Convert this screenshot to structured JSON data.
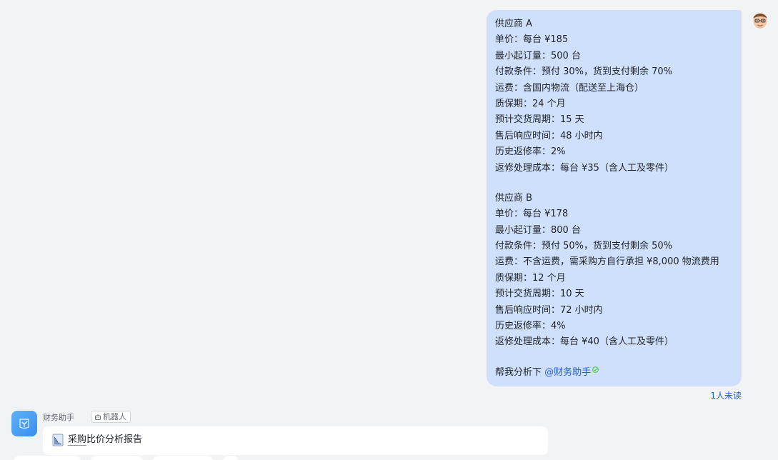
{
  "user_message": {
    "supplier_a": {
      "header": "供应商 A",
      "lines": [
        "单价：每台 ¥185",
        "最小起订量：500 台",
        "付款条件：预付 30%，货到支付剩余 70%",
        "运费：含国内物流（配送至上海仓）",
        "质保期：24 个月",
        "预计交货周期：15 天",
        "售后响应时间：48 小时内",
        "历史返修率：2%",
        "返修处理成本：每台 ¥35（含人工及零件）"
      ]
    },
    "supplier_b": {
      "header": "供应商 B",
      "lines": [
        "单价：每台 ¥178",
        "最小起订量：800 台",
        "付款条件：预付 50%，货到支付剩余 50%",
        "运费：不含运费，需采购方自行承担 ¥8,000 物流费用",
        "质保期：12 个月",
        "预计交货周期：10 天",
        "售后响应时间：72 小时内",
        "历史返修率：4%",
        "返修处理成本：每台 ¥40（含人工及零件）"
      ]
    },
    "request_text": "帮我分析下 ",
    "mention": "@财务助手",
    "read_status": "1人未读"
  },
  "bot": {
    "name": "财务助手",
    "tag_label": "机器人",
    "card_title_link": "采购",
    "card_title_rest": "比价分析报告"
  },
  "colors": {
    "bubble_bg": "#cfe0fc",
    "accent": "#245bdb",
    "background": "#f2f3f5"
  }
}
